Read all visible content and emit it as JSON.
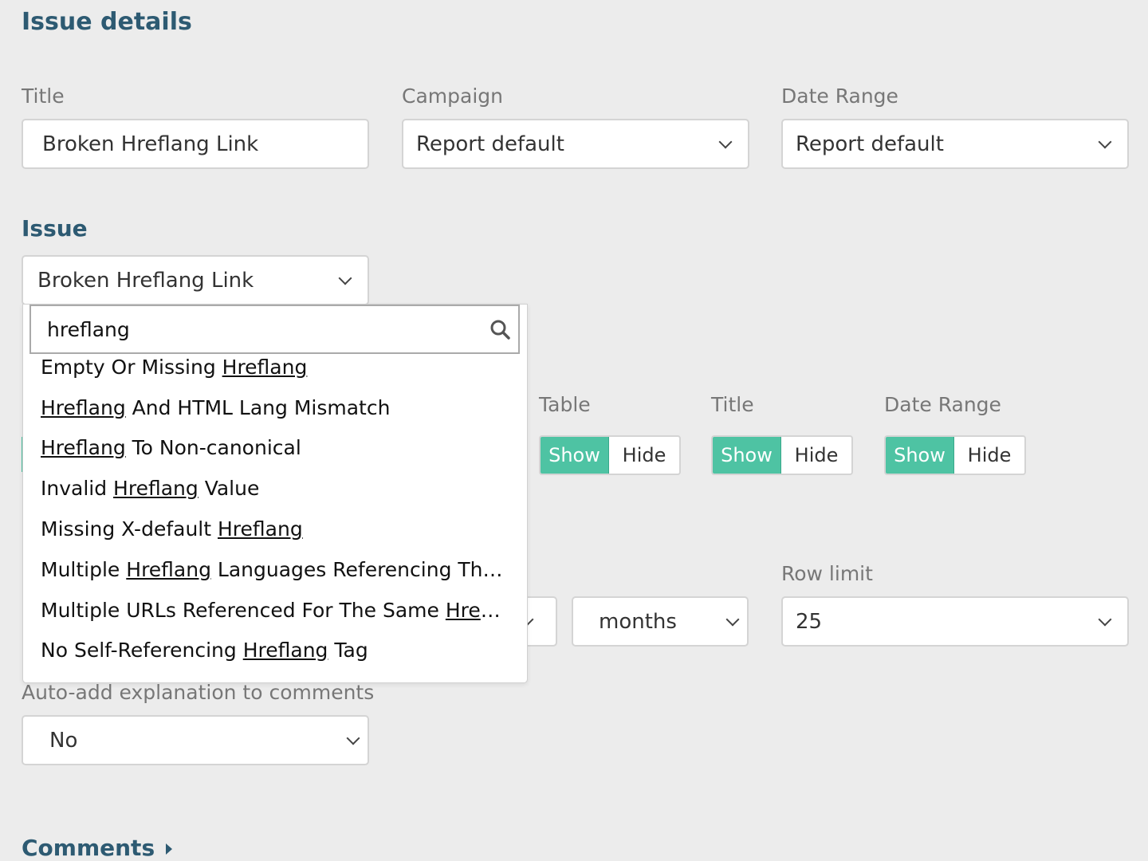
{
  "page_title": "Issue details",
  "title_field": {
    "label": "Title",
    "value": "Broken Hreflang Link"
  },
  "campaign_field": {
    "label": "Campaign",
    "value": "Report default"
  },
  "date_range_field": {
    "label": "Date Range",
    "value": "Report default"
  },
  "issue_section": {
    "heading": "Issue",
    "selected": "Broken Hreflang Link"
  },
  "issue_search": {
    "value": "hreflang",
    "highlight": "Hreflang"
  },
  "issue_options": [
    {
      "pre": "Empty Or Missing ",
      "match": "Hreflang",
      "post": ""
    },
    {
      "pre": "",
      "match": "Hreflang",
      "post": " And HTML Lang Mismatch"
    },
    {
      "pre": "",
      "match": "Hreflang",
      "post": " To Non-canonical"
    },
    {
      "pre": "Invalid ",
      "match": "Hreflang",
      "post": " Value"
    },
    {
      "pre": "Missing X-default ",
      "match": "Hreflang",
      "post": ""
    },
    {
      "pre": "Multiple ",
      "match": "Hreflang",
      "post": " Languages Referencing The S..."
    },
    {
      "pre": "Multiple URLs Referenced For The Same ",
      "match": "Hrefla...",
      "post": ""
    },
    {
      "pre": "No Self-Referencing ",
      "match": "Hreflang",
      "post": " Tag"
    }
  ],
  "visibility_toggles": [
    {
      "label": "Table",
      "show": "Show",
      "hide": "Hide"
    },
    {
      "label": "Title",
      "show": "Show",
      "hide": "Hide"
    },
    {
      "label": "Date Range",
      "show": "Show",
      "hide": "Hide"
    }
  ],
  "period_unit": {
    "value": "months"
  },
  "row_limit": {
    "label": "Row limit",
    "value": "25"
  },
  "auto_explanation": {
    "label": "Auto-add explanation to comments",
    "value": "No"
  },
  "comments": {
    "label": "Comments"
  },
  "colors": {
    "accent": "#4ec3a3",
    "heading": "#2d5a72"
  }
}
